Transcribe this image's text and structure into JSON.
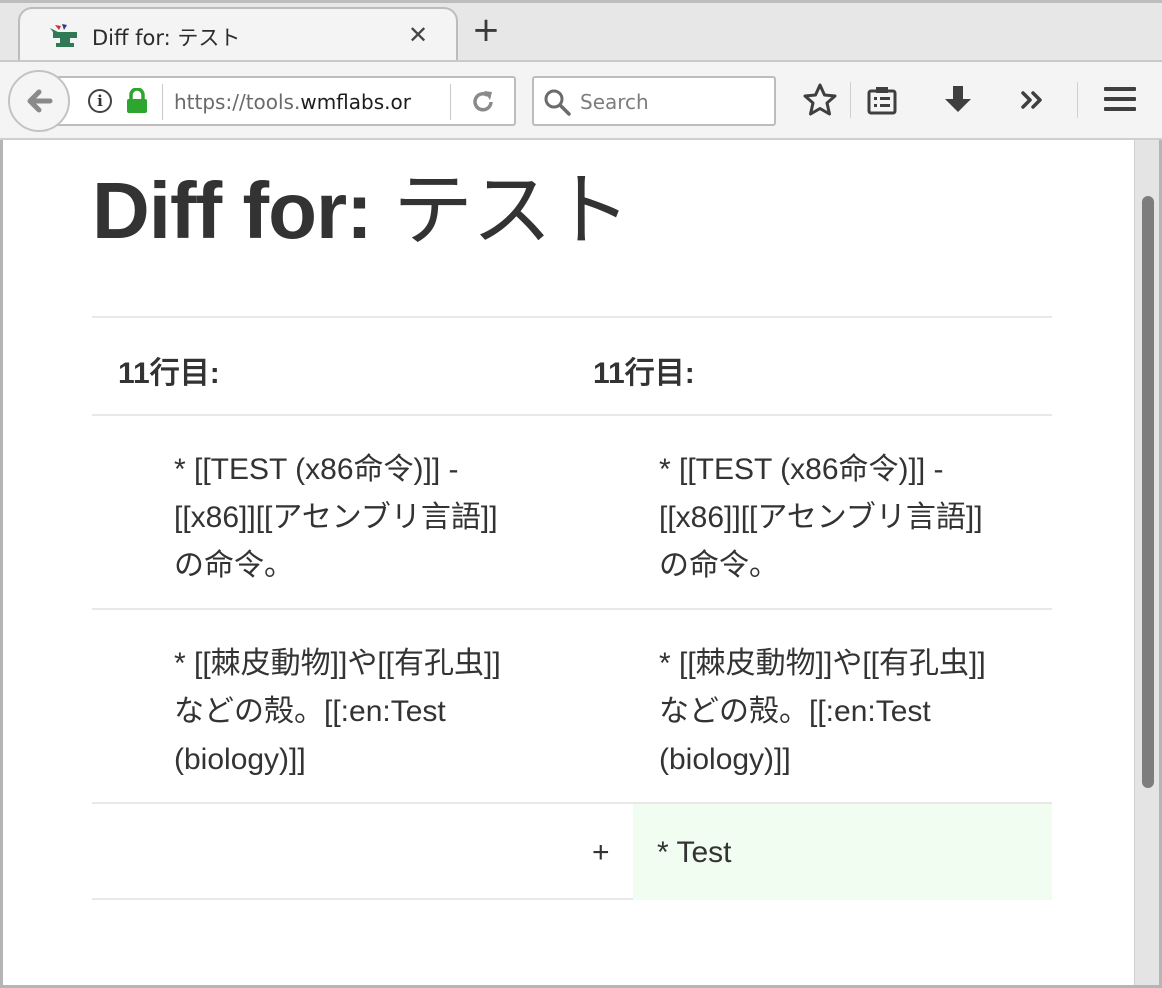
{
  "browser": {
    "tab": {
      "title": "Diff for: テスト",
      "close": "✕"
    },
    "new_tab": "+",
    "url": {
      "prefix": "https://tools.",
      "domain": "wmflabs.or"
    },
    "search_placeholder": "Search",
    "icons": [
      "back-arrow-icon",
      "info-icon",
      "lock-icon",
      "reload-icon",
      "search-icon",
      "bookmark-star-icon",
      "reading-list-icon",
      "download-icon",
      "overflow-chevron-icon",
      "hamburger-menu-icon"
    ],
    "colors": {
      "lock": "#2ea52e",
      "added_bg": "#f0fdf0"
    }
  },
  "page": {
    "title_bold": "Diff for:",
    "title_rest": " テスト"
  },
  "diff": {
    "left_lineno": "11行目:",
    "right_lineno": "11行目:",
    "context_rows": [
      {
        "left": [
          "* [[TEST (x86命令)]] -",
          "[[x86]][[アセンブリ言語]]",
          "の命令。"
        ],
        "right": [
          "* [[TEST (x86命令)]] -",
          "[[x86]][[アセンブリ言語]]",
          "の命令。"
        ]
      },
      {
        "left": [
          "* [[棘皮動物]]や[[有孔虫]]",
          "などの殻。[[:en:Test",
          "(biology)]]"
        ],
        "right": [
          "* [[棘皮動物]]や[[有孔虫]]",
          "などの殻。[[:en:Test",
          "(biology)]]"
        ]
      }
    ],
    "added": {
      "marker": "+",
      "text": "* Test"
    }
  }
}
